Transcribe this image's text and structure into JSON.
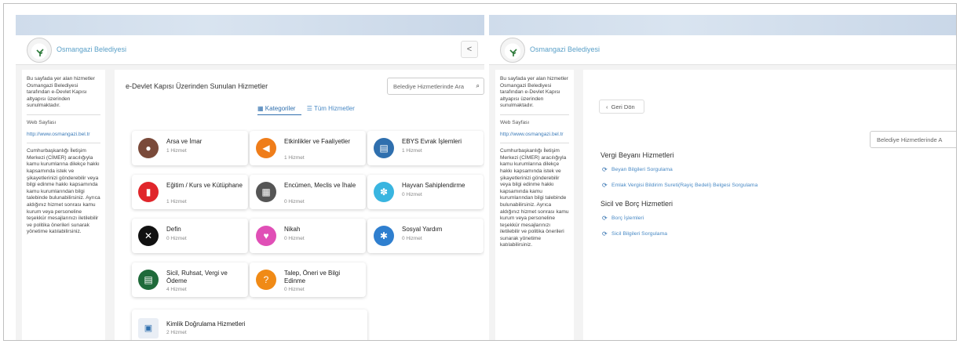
{
  "brand_name": "Osmangazi Belediyesi",
  "sidebar": {
    "intro": "Bu sayfada yer alan hizmetler Osmangazi Belediyesi tarafından e-Devlet Kapısı altyapısı üzerinden sunulmaktadır.",
    "web_label": "Web Sayfası",
    "web_link": "http://www.osmangazi.bel.tr",
    "cimer_text": "Cumhurbaşkanlığı İletişim Merkezi (CİMER) aracılığıyla kamu kurumlarına dilekçe hakkı kapsamında istek ve şikayetlerinizi gönderebilir veya bilgi edinme hakkı kapsamında kamu kurumlarından bilgi talebinde bulunabilirsiniz. Ayrıca aldığınız hizmet sonrası kamu kurum veya personeline teşekkür mesajlarınızı iletilebilir ve politika önerileri sunarak yönetime katılabilirsiniz."
  },
  "left": {
    "title": "e-Devlet Kapısı Üzerinden Sunulan Hizmetler",
    "search_placeholder": "Belediye Hizmetlerinde Ara",
    "tabs": [
      "Kategoriler",
      "Tüm Hizmetler"
    ],
    "categories": [
      {
        "title": "Arsa ve İmar",
        "count": "1 Hizmet",
        "icon": "map-pin-icon",
        "color": "#7a4a3a"
      },
      {
        "title": "Etkinlikler ve Faaliyetler",
        "count": "1 Hizmet",
        "icon": "megaphone-icon",
        "color": "#ef7d1a"
      },
      {
        "title": "EBYS Evrak İşlemleri",
        "count": "1 Hizmet",
        "icon": "document-icon",
        "color": "#2f6fae"
      },
      {
        "title": "Eğitim / Kurs ve Kütüphane",
        "count": "1 Hizmet",
        "icon": "book-icon",
        "color": "#e0262b"
      },
      {
        "title": "Encümen, Meclis ve İhale",
        "count": "0 Hizmet",
        "icon": "building-icon",
        "color": "#555555"
      },
      {
        "title": "Hayvan Sahiplendirme",
        "count": "0 Hizmet",
        "icon": "paw-icon",
        "color": "#39b5e0"
      },
      {
        "title": "Defin",
        "count": "0 Hizmet",
        "icon": "ribbon-icon",
        "color": "#111111"
      },
      {
        "title": "Nikah",
        "count": "0 Hizmet",
        "icon": "couple-icon",
        "color": "#e04fb6"
      },
      {
        "title": "Sosyal Yardım",
        "count": "0 Hizmet",
        "icon": "people-circle-icon",
        "color": "#2f7fcf"
      },
      {
        "title": "Sicil, Ruhsat, Vergi ve Ödeme",
        "count": "4 Hizmet",
        "icon": "receipt-icon",
        "color": "#1f6a3a"
      },
      {
        "title": "Talep, Öneri ve Bilgi Edinme",
        "count": "0 Hizmet",
        "icon": "question-icon",
        "color": "#f08a16"
      }
    ],
    "wide_card": {
      "title": "Kimlik Doğrulama Hizmetleri",
      "count": "2 Hizmet",
      "icon": "id-card-icon"
    }
  },
  "right": {
    "back_label": "Geri Dön",
    "search_placeholder": "Belediye Hizmetlerinde A",
    "sections": [
      {
        "title": "Vergi Beyanı Hizmetleri",
        "items": [
          "Beyan Bilgileri Sorgulama",
          "Emlak Vergisi Bildirim Sureti(Rayiç Bedeli) Belgesi Sorgulama"
        ]
      },
      {
        "title": "Sicil ve Borç Hizmetleri",
        "items": [
          "Borç İşlemleri",
          "Sicil Bilgileri Sorgulama"
        ]
      }
    ]
  }
}
